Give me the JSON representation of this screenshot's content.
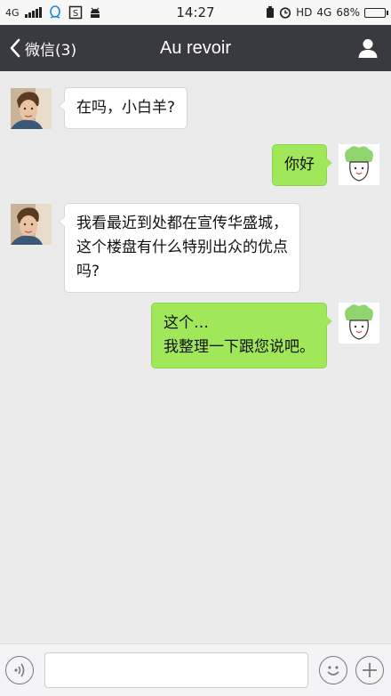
{
  "status_bar": {
    "network": "4G",
    "time": "14:27",
    "hd_label": "HD",
    "network_right": "4G",
    "battery_percent": "68%",
    "battery_level": 0.68
  },
  "header": {
    "back_label": "微信(3)",
    "title": "Au revoir"
  },
  "messages": [
    {
      "side": "in",
      "lines": [
        "在吗，小白羊?"
      ]
    },
    {
      "side": "out",
      "lines": [
        "你好"
      ]
    },
    {
      "side": "in",
      "lines": [
        "我看最近到处都在宣传华盛城，",
        "这个楼盘有什么特别出众的优点",
        "吗?"
      ]
    },
    {
      "side": "out",
      "lines": [
        "这个…",
        "我整理一下跟您说吧。"
      ]
    }
  ],
  "input": {
    "value": "",
    "placeholder": ""
  },
  "icons": {
    "voice": "voice-icon",
    "emoji": "emoji-icon",
    "add": "add-icon",
    "profile": "profile-icon",
    "back": "chevron-left-icon"
  },
  "colors": {
    "titlebar": "#393a3f",
    "outgoing_bubble": "#a0e75a",
    "incoming_bubble": "#ffffff",
    "chat_background": "#ebebeb"
  }
}
